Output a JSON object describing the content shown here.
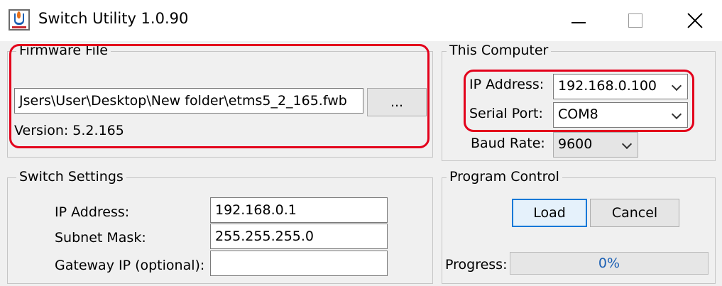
{
  "window": {
    "title": "Switch Utility 1.0.90",
    "icon": "java-cup-icon"
  },
  "firmware": {
    "group_title": "Firmware File",
    "path_value": "Jsers\\User\\Desktop\\New folder\\etms5_2_165.fwb",
    "browse_label": "...",
    "version_text": "Version: 5.2.165"
  },
  "computer": {
    "group_title": "This Computer",
    "ip_label": "IP Address:",
    "ip_value": "192.168.0.100",
    "serial_label": "Serial Port:",
    "serial_value": "COM8",
    "baud_label": "Baud Rate:",
    "baud_value": "9600"
  },
  "switch": {
    "group_title": "Switch Settings",
    "ip_label": "IP Address:",
    "ip_value": "192.168.0.1",
    "subnet_label": "Subnet Mask:",
    "subnet_value": "255.255.255.0",
    "gateway_label": "Gateway IP (optional):",
    "gateway_value": ""
  },
  "program": {
    "group_title": "Program Control",
    "load_label": "Load",
    "cancel_label": "Cancel",
    "progress_label": "Progress:",
    "progress_text": "0%",
    "progress_value": 0
  },
  "colors": {
    "highlight": "#e3001b",
    "accent": "#0078d7",
    "progress_text": "#1a5fb4"
  }
}
